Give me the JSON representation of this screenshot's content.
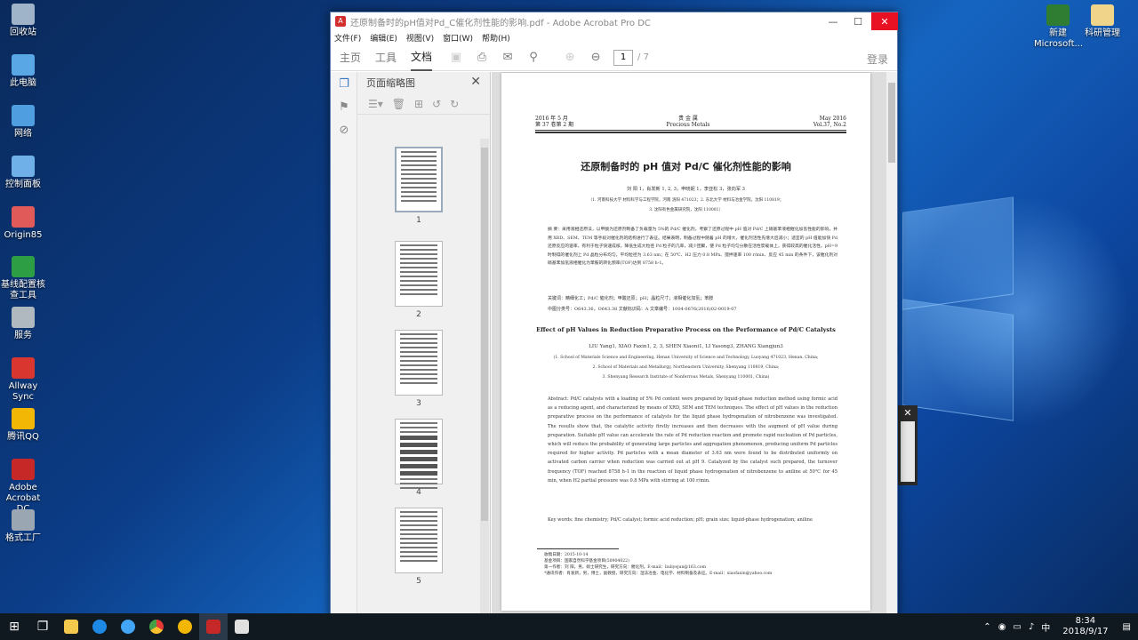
{
  "desktop": {
    "icons_left": [
      {
        "label": "回收站",
        "name": "recycle-bin-icon",
        "color": "#9fb4c8"
      },
      {
        "label": "此电脑",
        "name": "this-pc-icon",
        "color": "#5aa7e6"
      },
      {
        "label": "网络",
        "name": "network-icon",
        "color": "#4f9fe0"
      },
      {
        "label": "控制面板",
        "name": "control-panel-icon",
        "color": "#6fb0e8"
      },
      {
        "label": "Origin85",
        "name": "origin-icon",
        "color": "#e05a5a"
      },
      {
        "label": "基线配置核查工具",
        "name": "baseline-tool-icon",
        "color": "#2e9e44"
      },
      {
        "label": "服务",
        "name": "services-icon",
        "color": "#b0b8c0"
      },
      {
        "label": "Allway Sync",
        "name": "allway-sync-icon",
        "color": "#d8362f"
      },
      {
        "label": "腾讯QQ",
        "name": "qq-icon",
        "color": "#f2b705"
      },
      {
        "label": "Adobe Acrobat DC",
        "name": "acrobat-dc-icon",
        "color": "#c62828"
      },
      {
        "label": "格式工厂",
        "name": "format-factory-icon",
        "color": "#9aa6b2"
      }
    ],
    "icons_right": [
      {
        "label": "新建 Microsoft...",
        "name": "new-excel-file-icon",
        "color": "#2e7d32"
      },
      {
        "label": "科研管理",
        "name": "research-folder-icon",
        "color": "#f0d48a"
      }
    ]
  },
  "window": {
    "title": "还原制备时的pH值对Pd_C催化剂性能的影响.pdf - Adobe Acrobat Pro DC",
    "menu": [
      "文件(F)",
      "编辑(E)",
      "视图(V)",
      "窗口(W)",
      "帮助(H)"
    ],
    "tabs": [
      "主页",
      "工具",
      "文档"
    ],
    "page_current": "1",
    "page_total": "/ 7",
    "login": "登录"
  },
  "thumb_panel": {
    "title": "页面缩略图",
    "pages": [
      "1",
      "2",
      "3",
      "4",
      "5"
    ]
  },
  "paper": {
    "header_left_1": "2016 年 5 月",
    "header_left_2": "第 37 卷第 2 期",
    "header_center_1": "贵 金 属",
    "header_center_2": "Precious Metals",
    "header_right_1": "May 2016",
    "header_right_2": "Vol.37, No.2",
    "title_zh": "还原制备时的 pH 值对 Pd/C 催化剂性能的影响",
    "authors_zh": "刘  阳 1，肖发新 1, 2, 3，申晓妮 1，李亚松 3，张向军 3",
    "affil_zh_1": "（1. 河南科技大学 材料科学与工程学院，河南 洛阳 471023；2. 东北大学 材料与冶金学院，沈阳 110819；",
    "affil_zh_2": "3. 沈阳有色金属研究院，沈阳 110001）",
    "abstract_zh": "摘  要：采用液相还原法，以甲酸为还原剂制备了负载量为 5%的 Pd/C 催化剂，考察了还原过程中 pH 值对 Pd/C 上硝基苯液相催化加氢性能的影响，并用 XRD、SEM、TEM 等手段对催化剂的结构进行了表征。结果表明，制备过程中随着 pH 的增大，催化剂活性先增大后减小；适宜的 pH 值能加快 Pd 还原反应的速率，有利于粒子快速成核，降低生成大粒径 Pd 粒子的几率，减少团聚，使 Pd 粒子均匀分散在活性炭载体上，获得较高的催化活性。pH=9 时制得的催化剂上 Pd 晶粒分布均匀，平均粒径为 3.63 nm；在 50℃、H2 压力 0.8 MPa、搅拌速率 100 r/min、反应 45 min 的条件下，该催化剂对硝基苯加氢液相催化为苯胺的转化频率(TOF)达到 8758 h-1。",
    "keywords_zh": "关键词：精细化工；Pd/C 催化剂；甲酸还原；pH；晶粒尺寸；液相催化加氢；苯胺",
    "class_zh": "中图分类号：O643.36，O643.38    文献标识码：A    文章编号：1004-0676(2016)02-0019-07",
    "title_en": "Effect of pH Values in Reduction Preparative Process on the Performance of Pd/C Catalysts",
    "authors_en": "LIU Yang1, XIAO Faxin1, 2, 3, SHEN Xiaoni1, LI Yasong3, ZHANG Xiangjun3",
    "affil_en_1": "(1. School of Materials Science and Engineering, Henan University of Science and Technology, Luoyang 471023, Henan, China;",
    "affil_en_2": "2. School of Materials and Metallurgy, Northeastern University, Shenyang 110819, China;",
    "affil_en_3": "3. Shenyang Research Institute of Nonferrous Metals, Shenyang 110001, China)",
    "abstract_en": "Abstract: Pd/C catalysts with a loading of 5% Pd content were prepared by liquid-phase reduction method using formic acid as a reducing agent, and characterized by means of XRD, SEM and TEM techniques. The effect of pH values in the reduction preparative process on the performance of catalysts for the liquid phase hydrogenation of nitrobenzene was investigated. The results show that, the catalytic activity firstly increases and then decreases with the augment of pH value during preparation. Suitable pH value can accelerate the rate of Pd reduction reaction and promote rapid nucleation of Pd particles, which will reduce the probability of generating large particles and aggregation phenomenon, producing uniform Pd particles required for higher activity. Pd particles with a mean diameter of 3.63 nm were found to be distributed uniformly on activated carbon carrier when reduction was carried out at pH 9. Catalyzed by the catalyst such prepared, the turnover frequency (TOF) reached 8758 h-1 in the reaction of liquid phase hydrogenation of nitrobenzene to aniline at 50℃ for 45 min, when H2 partial pressure was 0.8 MPa with stirring at 100 r/min.",
    "keywords_en": "Key words: fine chemistry; Pd/C catalyst; formic acid reduction; pH; grain size; liquid-phase hydrogenation; aniline",
    "footnote_1": "收稿日期：2015-10-14",
    "footnote_2": "基金项目：国家自然科学基金项目(50904022)",
    "footnote_3": "第一作者：刘  阳，男，硕士研究生，研究方向：催化剂。E-mail：liuliyejun@163.com",
    "footnote_4": "*通讯作者：肖发新，男，博士，副教授，研究方向：湿法冶金、电化学、材料制备及表征。E-mail：xiaofaxin@yahoo.com"
  },
  "taskbar": {
    "time": "8:34",
    "date": "2018/9/17",
    "ime": "中"
  }
}
